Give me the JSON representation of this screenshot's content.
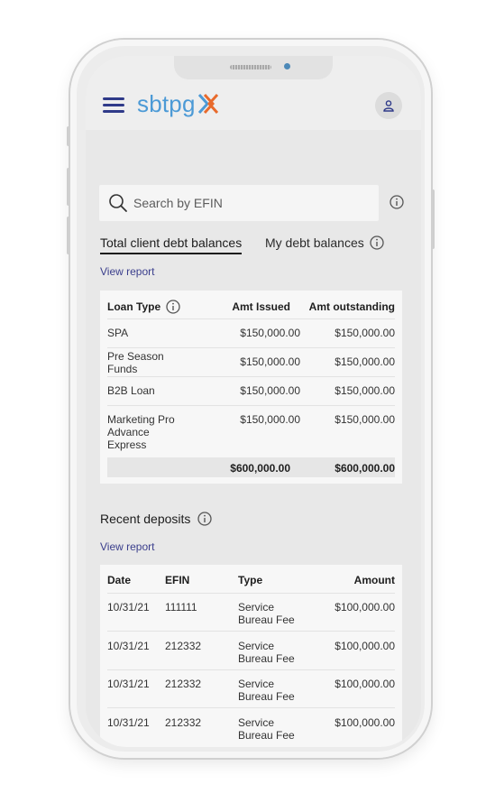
{
  "app": {
    "logo_text": "sbtpg",
    "accent_color": "#4c9ad6",
    "brand_orange": "#e86a2c",
    "nav_color": "#2f3a89"
  },
  "search": {
    "placeholder": "Search by EFIN"
  },
  "tabs": [
    {
      "label": "Total client debt balances",
      "active": true
    },
    {
      "label": "My debt balances",
      "active": false
    }
  ],
  "debt": {
    "view_report": "View report",
    "columns": [
      "Loan Type",
      "Amt Issued",
      "Amt outstanding"
    ],
    "rows": [
      {
        "type": "SPA",
        "issued": "$150,000.00",
        "outstanding": "$150,000.00"
      },
      {
        "type": "Pre Season\nFunds",
        "issued": "$150,000.00",
        "outstanding": "$150,000.00"
      },
      {
        "type": "B2B Loan",
        "issued": "$150,000.00",
        "outstanding": "$150,000.00"
      },
      {
        "type": "Marketing Pro\nAdvance\nExpress",
        "issued": "$150,000.00",
        "outstanding": "$150,000.00"
      }
    ],
    "total_issued": "$600,000.00",
    "total_outstanding": "$600,000.00"
  },
  "deposits": {
    "title": "Recent deposits",
    "view_report": "View report",
    "columns": [
      "Date",
      "EFIN",
      "Type",
      "Amount"
    ],
    "rows": [
      {
        "date": "10/31/21",
        "efin": "111111",
        "type": "Service\nBureau Fee",
        "amount": "$100,000.00"
      },
      {
        "date": "10/31/21",
        "efin": "212332",
        "type": "Service\nBureau Fee",
        "amount": "$100,000.00"
      },
      {
        "date": "10/31/21",
        "efin": "212332",
        "type": "Service\nBureau Fee",
        "amount": "$100,000.00"
      },
      {
        "date": "10/31/21",
        "efin": "212332",
        "type": "Service\nBureau Fee",
        "amount": "$100,000.00"
      }
    ]
  }
}
